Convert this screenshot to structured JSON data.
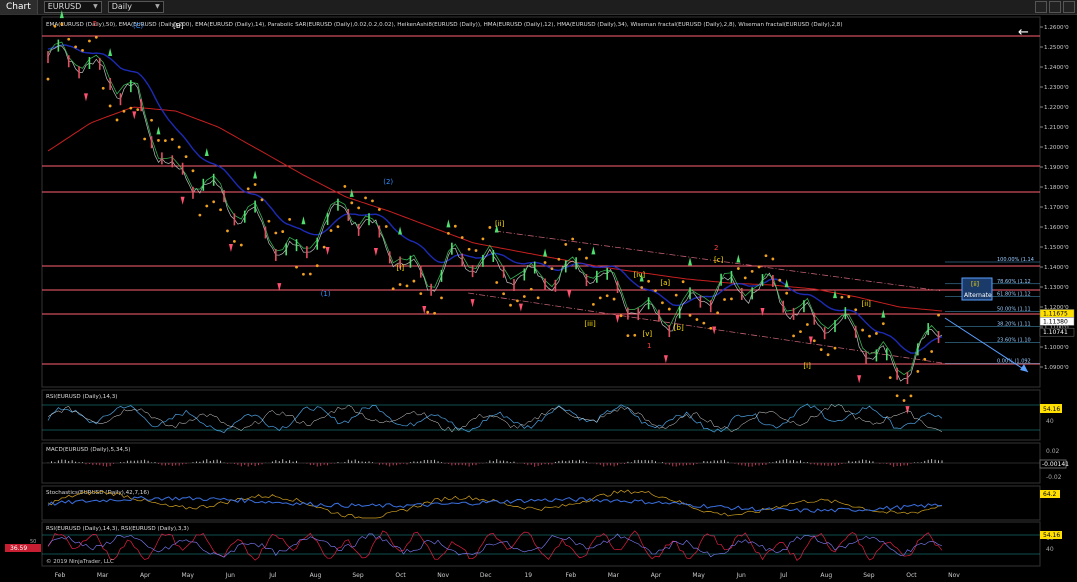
{
  "toolbar": {
    "tab_label": "Chart",
    "instrument": "EURUSD",
    "period": "Daily"
  },
  "colors": {
    "background": "#000000",
    "price_line": "#c0c0c0",
    "ema200": "#c62020",
    "ema50": "#2030c8",
    "sar": "#f0a020",
    "hma": "#40d060",
    "support": "#ff6070",
    "channel": "#c06070",
    "fib": "#ffffff"
  },
  "price_panel": {
    "indicator_label": "EMA(EURUSD (Daily),50), EMA(EURUSD (Daily),200), EMA(EURUSD (Daily),14), Parabolic SAR(EURUSD (Daily),0.02,0.2,0.02), HeikenAshi8(EURUSD (Daily)), HMA(EURUSD (Daily),12), HMA(EURUSD (Daily),34), Wiseman fractal(EURUSD (Daily),2,8), Wiseman fractal(EURUSD (Daily),2,8)",
    "back_arrow": "←",
    "price_ticks": [
      "1.2600'0",
      "1.2500'0",
      "1.2400'0",
      "1.2300'0",
      "1.2200'0",
      "1.2100'0",
      "1.2000'0",
      "1.1900'0",
      "1.1800'0",
      "1.1700'0",
      "1.1600'0",
      "1.1500'0",
      "1.1400'0",
      "1.1300'0",
      "1.1200'0",
      "1.1100'0",
      "1.1000'0",
      "1.0900'0"
    ],
    "price_tick_values": [
      1.26,
      1.25,
      1.24,
      1.23,
      1.22,
      1.21,
      1.2,
      1.19,
      1.18,
      1.17,
      1.16,
      1.15,
      1.14,
      1.13,
      1.12,
      1.11,
      1.1,
      1.09
    ],
    "ylim": [
      1.08,
      1.265
    ],
    "support_levels": [
      1.2555,
      1.1905,
      1.1775,
      1.1405,
      1.1285,
      1.1165,
      1.0915
    ],
    "price_badges": [
      {
        "text": "1.11675",
        "value": 1.11675,
        "bg": "#ffe000"
      },
      {
        "text": "1.11380",
        "value": 1.1128,
        "bg": "#ffffff"
      },
      {
        "text": "1.10741",
        "value": 1.1074,
        "bg": "#000000"
      }
    ],
    "fib_labels": [
      {
        "text": "100.00% (1.14",
        "value": 1.1425
      },
      {
        "text": "78.60% (1.12",
        "value": 1.1316
      },
      {
        "text": "61.80% (1.12",
        "value": 1.1252
      },
      {
        "text": "50.00% (1.11",
        "value": 1.1178
      },
      {
        "text": "38.20% (1.11",
        "value": 1.1103
      },
      {
        "text": "23.60% (1.10",
        "value": 1.1022
      },
      {
        "text": "0.00% (1.092",
        "value": 1.0918
      }
    ],
    "wave_labels": [
      {
        "text": "5",
        "x": 0.05,
        "value": 1.2605,
        "color": "#ff4040"
      },
      {
        "text": "(C)",
        "x": 0.095,
        "value": 1.2595,
        "color": "#3090ff"
      },
      {
        "text": "[B]",
        "x": 0.14,
        "value": 1.2595,
        "color": "#ffffff"
      },
      {
        "text": "(1)",
        "x": 0.305,
        "value": 1.1255,
        "color": "#3090ff"
      },
      {
        "text": "(2)",
        "x": 0.375,
        "value": 1.1815,
        "color": "#3090ff"
      },
      {
        "text": "[i]",
        "x": 0.39,
        "value": 1.1385,
        "color": "#ffe000"
      },
      {
        "text": "[ii]",
        "x": 0.5,
        "value": 1.1605,
        "color": "#ffe000"
      },
      {
        "text": "[iii]",
        "x": 0.6,
        "value": 1.1105,
        "color": "#ffe000"
      },
      {
        "text": "[iv]",
        "x": 0.655,
        "value": 1.135,
        "color": "#ffe000"
      },
      {
        "text": "[a]",
        "x": 0.685,
        "value": 1.131,
        "color": "#ffe000"
      },
      {
        "text": "[v]",
        "x": 0.665,
        "value": 1.1055,
        "color": "#ffe000"
      },
      {
        "text": "1",
        "x": 0.67,
        "value": 1.0995,
        "color": "#ff4040"
      },
      {
        "text": "[b]",
        "x": 0.7,
        "value": 1.1085,
        "color": "#ffe000"
      },
      {
        "text": "[c]",
        "x": 0.745,
        "value": 1.1425,
        "color": "#ffe000"
      },
      {
        "text": "2",
        "x": 0.745,
        "value": 1.1485,
        "color": "#ff4040"
      },
      {
        "text": "[i]",
        "x": 0.845,
        "value": 1.0895,
        "color": "#ffe000"
      },
      {
        "text": "[ii]",
        "x": 0.91,
        "value": 1.1205,
        "color": "#ffe000"
      }
    ],
    "alt_box": {
      "label_top": "[ii]",
      "label_bottom": "Alternate"
    }
  },
  "x_axis": {
    "labels": [
      "Feb",
      "Mar",
      "Apr",
      "May",
      "Jun",
      "Jul",
      "Aug",
      "Sep",
      "Oct",
      "Nov",
      "Dec",
      "19",
      "Feb",
      "Mar",
      "Apr",
      "May",
      "Jun",
      "Jul",
      "Aug",
      "Sep",
      "Oct",
      "Nov"
    ]
  },
  "rsi_panel": {
    "label": "RSI(EURUSD (Daily),14,3)",
    "value_badge": "54.16",
    "tick": "40",
    "top_tick": "60"
  },
  "macd_panel": {
    "label": "MACD(EURUSD (Daily),5,34,5)",
    "tick_top": "0.02",
    "badge": "-0.00141",
    "tick_bottom": "-0.02"
  },
  "stoch_panel": {
    "label": "Stochastics(EURUSD (Daily),42,7,16)",
    "badge": "64.2"
  },
  "rsi2_panel": {
    "label": "RSI(EURUSD (Daily),14,3), RSI(EURUSD (Daily),3,3)",
    "badge": "54.16",
    "tick_top": "60",
    "tick_bottom": "40",
    "left_badge": "36.59",
    "left_tick": "50"
  },
  "copyright": "© 2019 NinjaTrader, LLC",
  "chart_data": {
    "type": "line",
    "title": "",
    "instrument": "EURUSD",
    "timeframe": "Daily",
    "ylim": [
      1.08,
      1.265
    ],
    "x": [
      "Feb",
      "Mar",
      "Apr",
      "May",
      "Jun",
      "Jul",
      "Aug",
      "Sep",
      "Oct",
      "Nov",
      "Dec",
      "19",
      "Feb",
      "Mar",
      "Apr",
      "May",
      "Jun",
      "Jul",
      "Aug",
      "Sep",
      "Oct",
      "Nov"
    ],
    "series": [
      {
        "name": "EURUSD",
        "values": [
          1.245,
          1.232,
          1.235,
          1.185,
          1.168,
          1.168,
          1.145,
          1.163,
          1.158,
          1.133,
          1.137,
          1.145,
          1.136,
          1.128,
          1.123,
          1.118,
          1.122,
          1.138,
          1.113,
          1.098,
          1.095,
          1.112
        ]
      },
      {
        "name": "EMA(EURUSD (Daily),200)",
        "values": [
          1.198,
          1.212,
          1.22,
          1.218,
          1.21,
          1.198,
          1.186,
          1.175,
          1.168,
          1.16,
          1.152,
          1.148,
          1.144,
          1.14,
          1.137,
          1.134,
          1.132,
          1.131,
          1.129,
          1.125,
          1.12,
          1.118
        ]
      }
    ]
  }
}
